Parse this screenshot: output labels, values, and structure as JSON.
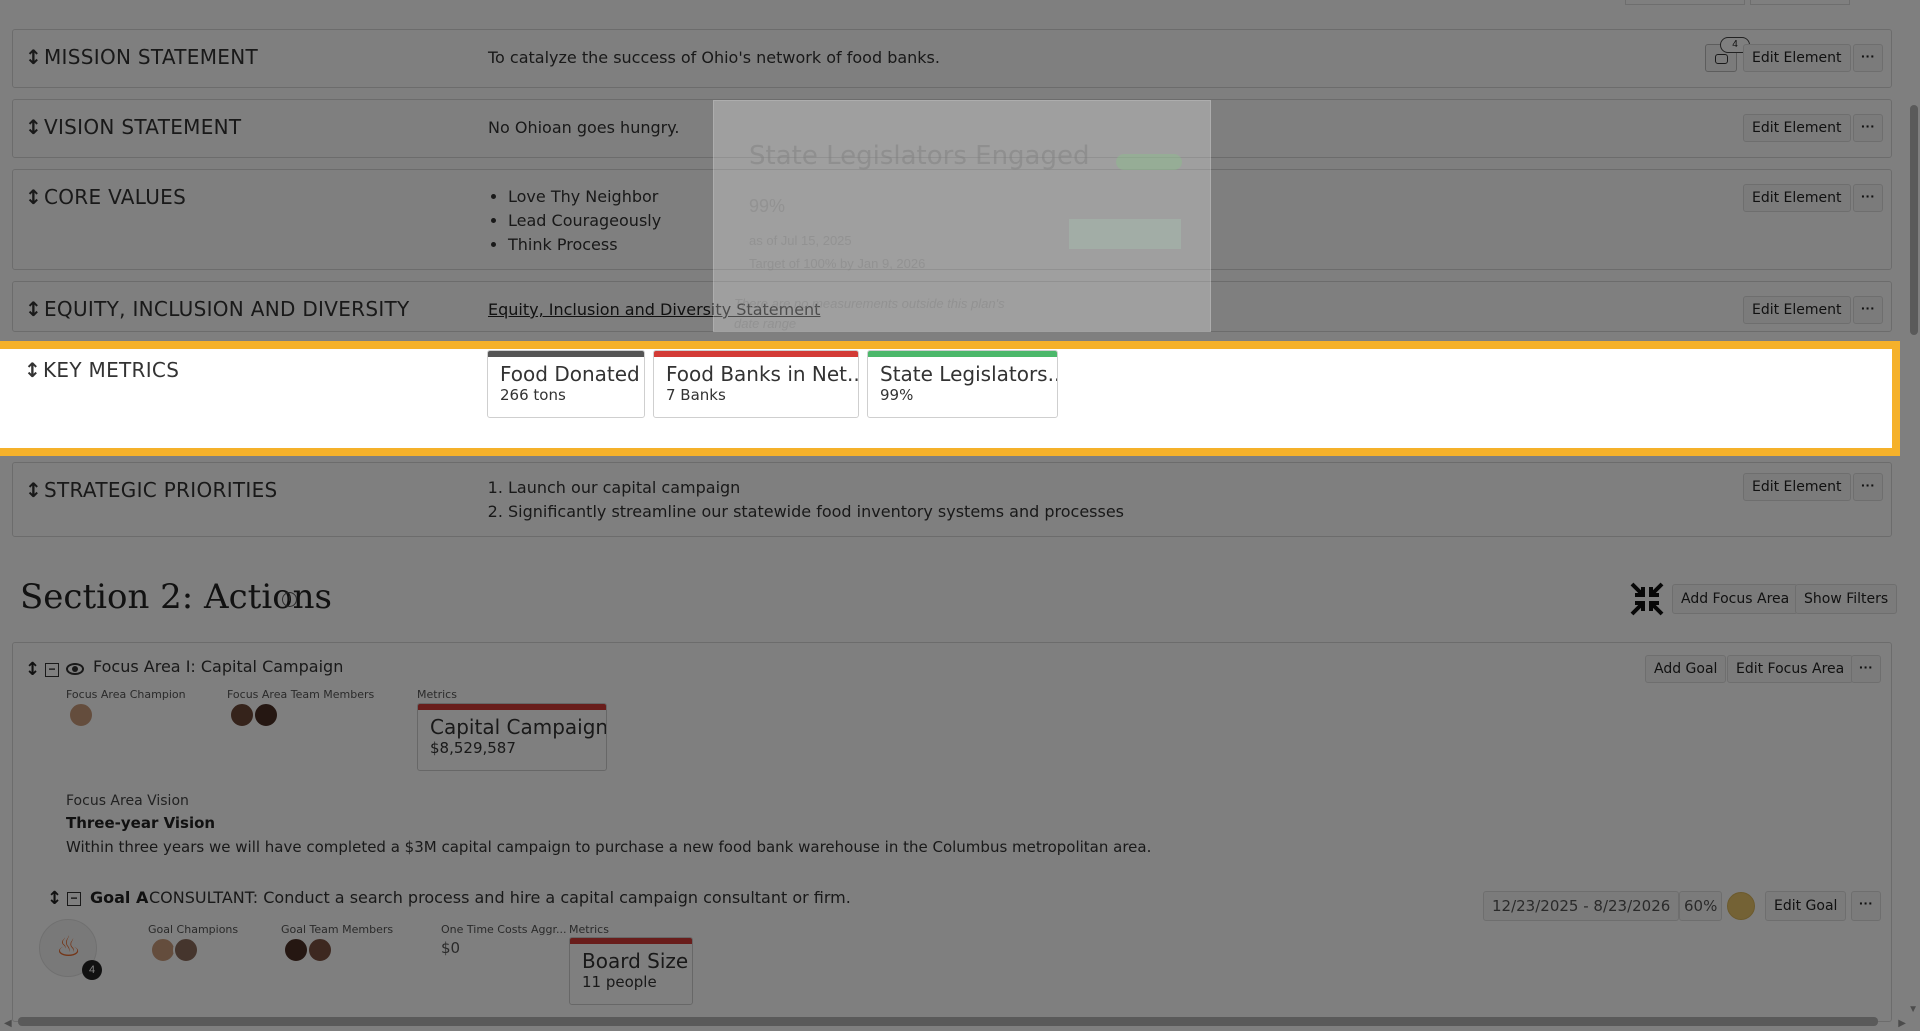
{
  "rows": {
    "mission": {
      "title": "MISSION STATEMENT",
      "content": "To catalyze the success of Ohio's network of food banks.",
      "comment_count": "4",
      "edit": "Edit Element",
      "more": "···"
    },
    "vision": {
      "title": "VISION STATEMENT",
      "content": "No Ohioan goes hungry.",
      "edit": "Edit Element",
      "more": "···"
    },
    "values": {
      "title": "CORE VALUES",
      "items": [
        "Love Thy Neighbor",
        "Lead Courageously",
        "Think Process"
      ],
      "edit": "Edit Element",
      "more": "···"
    },
    "equity": {
      "title": "EQUITY, INCLUSION AND DIVERSITY",
      "link": "Equity, Inclusion and Diversity Statement",
      "edit": "Edit Element",
      "more": "···"
    },
    "key_metrics": {
      "title": "KEY METRICS"
    },
    "priorities": {
      "title": "STRATEGIC PRIORITIES",
      "items": [
        "Launch our capital campaign",
        "Significantly streamline our statewide food inventory systems and processes"
      ],
      "edit": "Edit Element",
      "more": "···"
    }
  },
  "key_metrics": [
    {
      "name": "Food Donated",
      "value": "266 tons",
      "color": "#555555"
    },
    {
      "name": "Food Banks in Net...",
      "value": "7 Banks",
      "color": "#d33b36"
    },
    {
      "name": "State Legislators...",
      "value": "99%",
      "color": "#4cb86b"
    }
  ],
  "ghost_popup": {
    "title": "State Legislators Engaged",
    "percent": "99%",
    "as_of": "as of Jul 15, 2025",
    "target": "Target of 100% by Jan 9, 2026",
    "note_1": "There are no measurements outside this plan's",
    "note_2": "date range"
  },
  "section2": {
    "title": "Section 2: Actions",
    "add_focus_area": "Add Focus Area",
    "show_filters": "Show Filters"
  },
  "focus_area": {
    "title": "Focus Area I: Capital Campaign",
    "champion_label": "Focus Area Champion",
    "team_label": "Focus Area Team Members",
    "metrics_label": "Metrics",
    "metric": {
      "name": "Capital Campaign",
      "value": "$8,529,587",
      "color": "#d33b36"
    },
    "vision_label": "Focus Area Vision",
    "vision_title": "Three-year Vision",
    "vision_text": "Within three years we will have completed a $3M capital campaign to purchase a new food bank warehouse in the Columbus metropolitan area.",
    "add_goal": "Add Goal",
    "edit": "Edit Focus Area",
    "more": "···"
  },
  "goal": {
    "label": "Goal A",
    "text": "CONSULTANT: Conduct a search process and hire a capital campaign consultant or firm.",
    "badge_count": "4",
    "champions_label": "Goal Champions",
    "team_label": "Goal Team Members",
    "costs_label": "One Time Costs Aggr...",
    "costs_value": "$0",
    "metrics_label": "Metrics",
    "metric": {
      "name": "Board Size",
      "value": "11 people",
      "color": "#d33b36"
    },
    "dates": "12/23/2025 - 8/23/2026",
    "progress": "60%",
    "status_color": "#e9c46a",
    "edit": "Edit Goal",
    "more": "···"
  }
}
